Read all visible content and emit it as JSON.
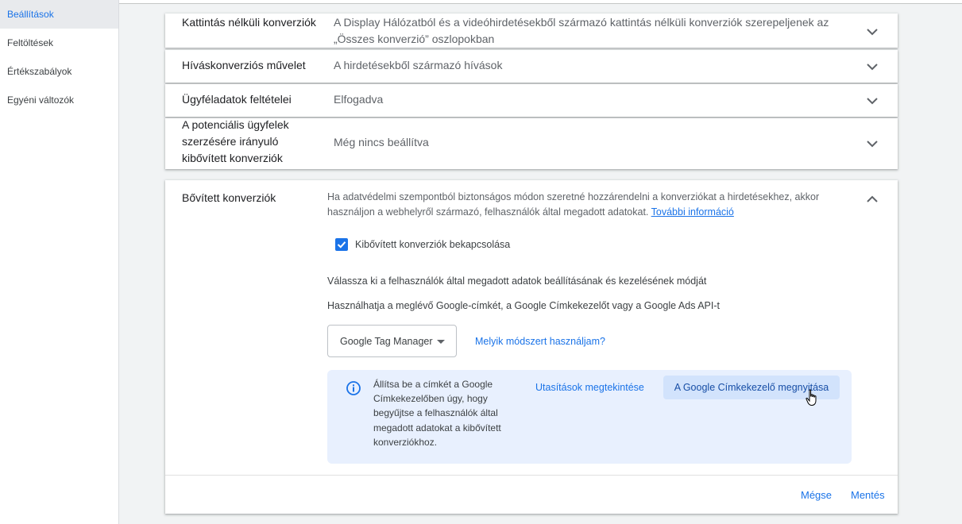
{
  "sidebar": {
    "items": [
      {
        "label": "Beállítások",
        "active": true
      },
      {
        "label": "Feltöltések"
      },
      {
        "label": "Értékszabályok"
      },
      {
        "label": "Egyéni változók"
      }
    ]
  },
  "rows": [
    {
      "label": "Kattintás nélküli konverziók",
      "value": "A Display Hálózatból és a videóhirdetésekből származó kattintás nélküli konverziók szerepeljenek az „Összes konverzió” oszlopokban"
    },
    {
      "label": "Híváskonverziós művelet",
      "value": "A hirdetésekből származó hívások"
    },
    {
      "label": "Ügyféladatok feltételei",
      "value": "Elfogadva"
    },
    {
      "label": "A potenciális ügyfelek szerzésére irányuló kibővített konverziók",
      "value": "Még nincs beállítva"
    }
  ],
  "expanded": {
    "label": "Bővített konverziók",
    "description": "Ha adatvédelmi szempontból biztonságos módon szeretné hozzárendelni a konverziókat a hirdetésekhez, akkor használjon a webhelyről származó, felhasználók által megadott adatokat.",
    "more_info": "További információ",
    "checkbox_label": "Kibővített konverziók bekapcsolása",
    "text_choose": "Válassza ki a felhasználók által megadott adatok beállításának és kezelésének módját",
    "text_usage": "Használhatja a meglévő Google-címkét, a Google Címkekezelőt vagy a Google Ads API-t",
    "select_value": "Google Tag Manager",
    "which_method_link": "Melyik módszert használjam?",
    "info_text": "Állítsa be a címkét a Google Címkekezelőben úgy, hogy begyűjtse a felhasználók által megadott adatokat a kibővített konverziókhoz.",
    "instructions_link": "Utasítások megtekintése",
    "open_gtm_button": "A Google Címkekezelő megnyitása",
    "cancel": "Mégse",
    "save": "Mentés"
  },
  "colors": {
    "accent": "#1a73e8",
    "info_bg": "#e8f0fe",
    "button_bg": "#d2e3fc"
  }
}
